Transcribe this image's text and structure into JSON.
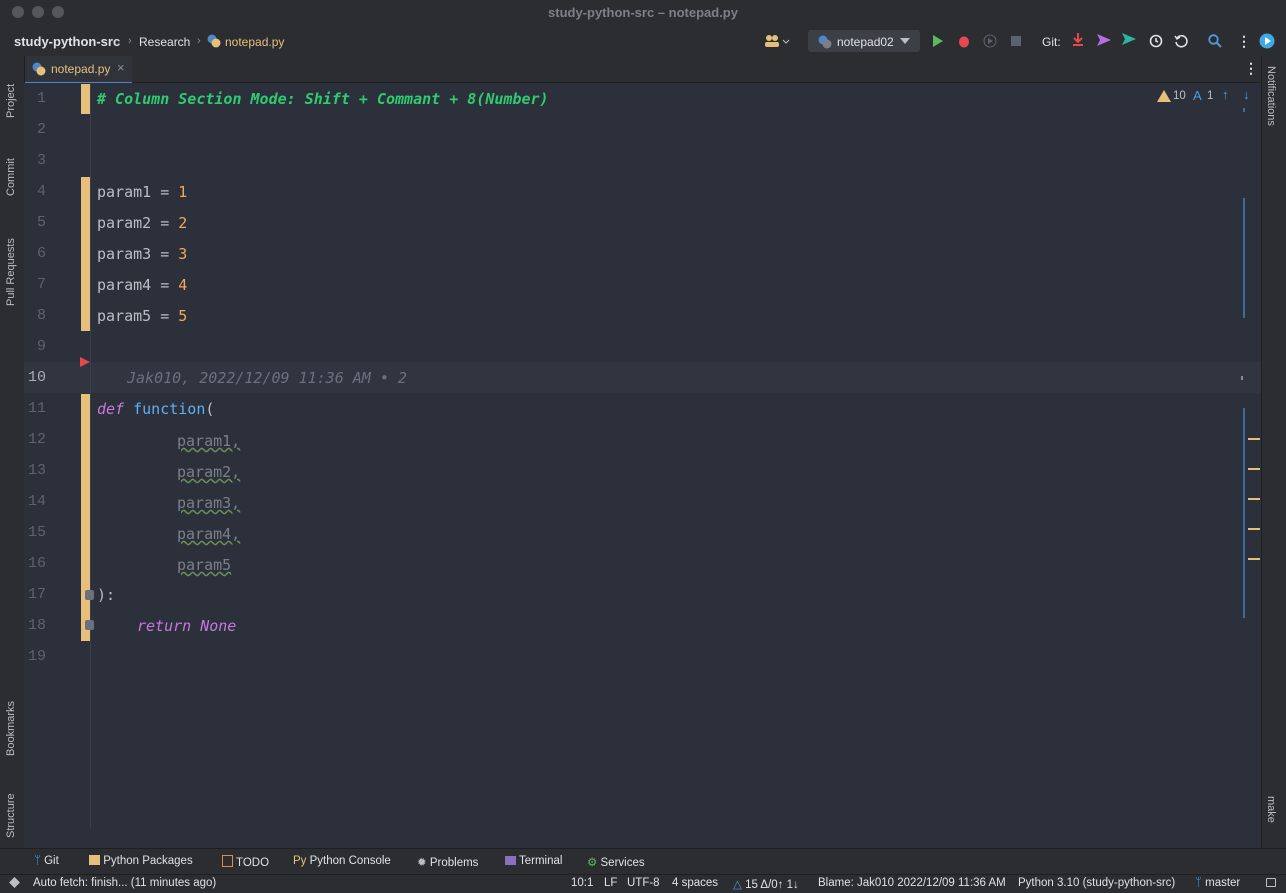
{
  "window": {
    "title": "study-python-src – notepad.py"
  },
  "nav": {
    "project": "study-python-src",
    "crumb1": "Research",
    "crumb2": "notepad.py",
    "run_config": "notepad02",
    "git_label": "Git:"
  },
  "tabs": [
    {
      "label": "notepad.py",
      "close": "×"
    }
  ],
  "left_tools": {
    "project": "Project",
    "commit": "Commit",
    "pull_requests": "Pull Requests",
    "bookmarks": "Bookmarks",
    "structure": "Structure"
  },
  "right_tools": {
    "notifications": "Notifications",
    "make": "make"
  },
  "inspections": {
    "warnings": "10",
    "typos": "1"
  },
  "editor": {
    "line_numbers": [
      "1",
      "2",
      "3",
      "4",
      "5",
      "6",
      "7",
      "8",
      "9",
      "10",
      "11",
      "12",
      "13",
      "14",
      "15",
      "16",
      "17",
      "18",
      "19"
    ],
    "comment": "# Column Section Mode: Shift + Commant + 8(Number)",
    "params": [
      {
        "name": "param1",
        "value": "1"
      },
      {
        "name": "param2",
        "value": "2"
      },
      {
        "name": "param3",
        "value": "3"
      },
      {
        "name": "param4",
        "value": "4"
      },
      {
        "name": "param5",
        "value": "5"
      }
    ],
    "blame": "Jak010, 2022/12/09 11:36 AM • 2",
    "def_kw": "def",
    "func_name": "function",
    "open_paren": "(",
    "args": [
      "param1,",
      "param2,",
      "param3,",
      "param4,",
      "param5"
    ],
    "close": "):",
    "return_line": "return None",
    "assign_op": " = "
  },
  "bottom_tools": [
    {
      "label": "Git"
    },
    {
      "label": "Python Packages"
    },
    {
      "label": "TODO"
    },
    {
      "label": "Python Console"
    },
    {
      "label": "Problems"
    },
    {
      "label": "Terminal"
    },
    {
      "label": "Services"
    }
  ],
  "status": {
    "message": "Auto fetch: finish... (11 minutes ago)",
    "position": "10:1",
    "line_sep": "LF",
    "encoding": "UTF-8",
    "indent": "4 spaces",
    "vcs_changes": "15 Δ/0↑ 1↓",
    "blame": "Blame: Jak010 2022/12/09 11:36 AM",
    "interpreter": "Python 3.10 (study-python-src)",
    "branch": "master"
  }
}
